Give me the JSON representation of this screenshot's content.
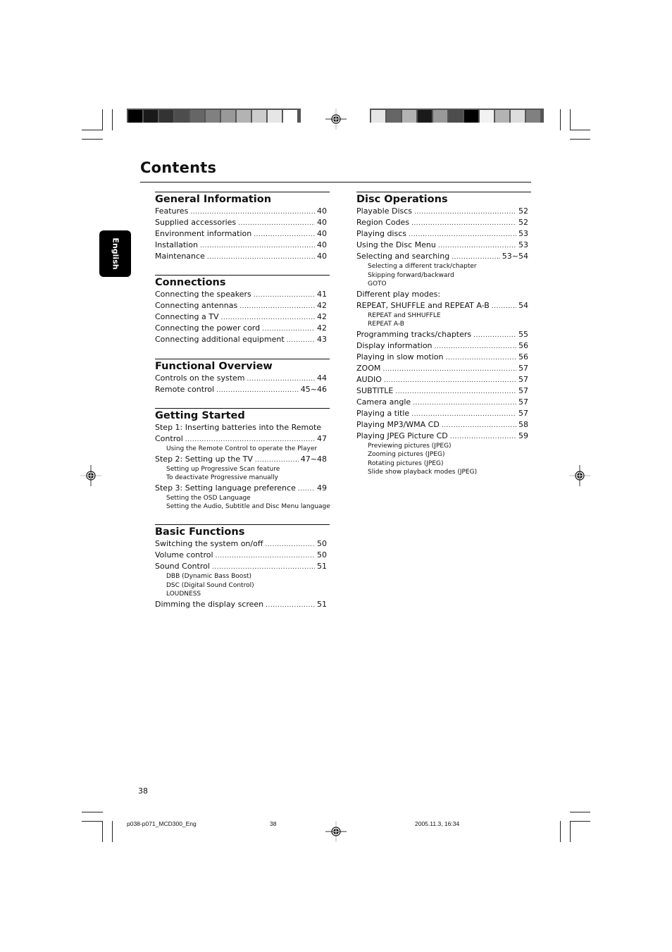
{
  "header": {
    "left_colorbar": [
      "#000000",
      "#1a1a1a",
      "#333333",
      "#4d4d4d",
      "#666666",
      "#808080",
      "#999999",
      "#b3b3b3",
      "#cccccc",
      "#e6e6e6",
      "#ffffff"
    ],
    "right_colorbar": [
      "#e6e6e6",
      "#666666",
      "#b3b3b3",
      "#1a1a1a",
      "#999999",
      "#4d4d4d",
      "#000000",
      "#f2f2f2",
      "#b3b3b3",
      "#dddddd",
      "#808080"
    ]
  },
  "language_tab": "English",
  "page_title": "Contents",
  "left_column": [
    {
      "heading": "General Information",
      "entries": [
        {
          "label": "Features",
          "page": "40"
        },
        {
          "label": "Supplied accessories",
          "page": "40"
        },
        {
          "label": "Environment information",
          "page": "40"
        },
        {
          "label": "Installation",
          "page": "40"
        },
        {
          "label": "Maintenance",
          "page": "40"
        }
      ]
    },
    {
      "heading": "Connections",
      "entries": [
        {
          "label": "Connecting the speakers",
          "page": "41"
        },
        {
          "label": "Connecting antennas",
          "page": "42"
        },
        {
          "label": "Connecting a TV",
          "page": "42"
        },
        {
          "label": "Connecting the power cord",
          "page": "42"
        },
        {
          "label": "Connecting additional equipment",
          "page": "43"
        }
      ]
    },
    {
      "heading": "Functional Overview",
      "entries": [
        {
          "label": "Controls on the system",
          "page": "44"
        },
        {
          "label": "Remote control",
          "page": "45~46"
        }
      ]
    },
    {
      "heading": "Getting Started",
      "step1_line1": "Step 1: Inserting batteries into the Remote",
      "step1_line2": "Control",
      "step1_page": "47",
      "step1_sub": [
        "Using the Remote Control to operate the Player"
      ],
      "step2_label": "Step 2: Setting up the TV",
      "step2_page": "47~48",
      "step2_sub": [
        "Setting up Progressive Scan feature",
        "To deactivate Progressive manually"
      ],
      "step3_label": "Step 3: Setting language preference",
      "step3_page": "49",
      "step3_sub": [
        "Setting the OSD Language",
        "Setting the Audio, Subtitle and Disc Menu language"
      ]
    },
    {
      "heading": "Basic Functions",
      "entries": [
        {
          "label": "Switching the system on/off",
          "page": "50"
        },
        {
          "label": "Volume control",
          "page": "50"
        },
        {
          "label": "Sound Control",
          "page": "51"
        }
      ],
      "sound_sub": [
        "DBB (Dynamic Bass Boost)",
        "DSC (Digital Sound Control)",
        "LOUDNESS"
      ],
      "last_entry": {
        "label": "Dimming the display screen",
        "page": "51"
      }
    }
  ],
  "right_column": {
    "heading": "Disc Operations",
    "entries_a": [
      {
        "label": "Playable Discs",
        "page": "52"
      },
      {
        "label": "Region Codes",
        "page": "52"
      },
      {
        "label": "Playing discs",
        "page": "53"
      },
      {
        "label": "Using the Disc Menu",
        "page": "53"
      },
      {
        "label": "Selecting and searching",
        "page": "53~54"
      }
    ],
    "selecting_sub": [
      "Selecting a different track/chapter",
      "Skipping forward/backward",
      "GOTO"
    ],
    "play_modes_label": "Different play modes:",
    "repeat_entry": {
      "label": "REPEAT, SHUFFLE and REPEAT A-B",
      "page": "54"
    },
    "repeat_sub": [
      "REPEAT and SHHUFFLE",
      "REPEAT A-B"
    ],
    "entries_b": [
      {
        "label": "Programming tracks/chapters",
        "page": "55"
      },
      {
        "label": "Display information",
        "page": "56"
      },
      {
        "label": "Playing in slow motion",
        "page": "56"
      },
      {
        "label": "ZOOM",
        "page": "57"
      },
      {
        "label": "AUDIO",
        "page": "57"
      },
      {
        "label": "SUBTITLE",
        "page": "57"
      },
      {
        "label": "Camera angle",
        "page": "57"
      },
      {
        "label": "Playing a title",
        "page": "57"
      },
      {
        "label": "Playing MP3/WMA CD",
        "page": "58"
      },
      {
        "label": "Playing JPEG Picture CD",
        "page": "59"
      }
    ],
    "jpeg_sub": [
      "Previewing pictures (JPEG)",
      "Zooming pictures (JPEG)",
      "Rotating pictures (JPEG)",
      "Slide show playback modes (JPEG)"
    ]
  },
  "page_number": "38",
  "footer": {
    "file_name": "p038-p071_MCD300_Eng",
    "sheet_number": "38",
    "timestamp": "2005.11.3, 16:34"
  }
}
